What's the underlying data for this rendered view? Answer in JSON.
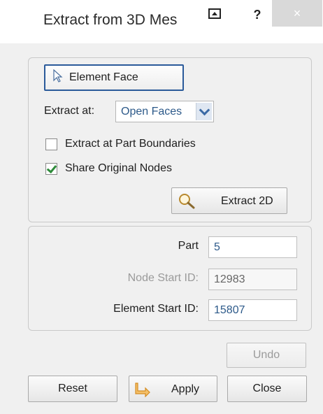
{
  "window": {
    "title": "Extract from 3D Mes",
    "help_label": "?",
    "close_label": "×"
  },
  "selection": {
    "element_face_label": "Element Face"
  },
  "extract_at": {
    "label": "Extract at:",
    "selected_option": "Open Faces"
  },
  "options": {
    "extract_at_part_boundaries": {
      "label": "Extract at Part Boundaries",
      "checked": false
    },
    "share_original_nodes": {
      "label": "Share Original Nodes",
      "checked": true
    }
  },
  "extract_button_label": "Extract 2D",
  "fields": {
    "part": {
      "label": "Part",
      "value": "5"
    },
    "node_start_id": {
      "label": "Node Start ID:",
      "value": "12983",
      "enabled": false
    },
    "element_start_id": {
      "label": "Element Start ID:",
      "value": "15807"
    }
  },
  "buttons": {
    "undo": "Undo",
    "reset": "Reset",
    "apply": "Apply",
    "close": "Close"
  },
  "colors": {
    "accent": "#2a5a9a",
    "value_text": "#2d5a8a",
    "check": "#2e8b3a",
    "apply_icon": "#e8a23a"
  }
}
